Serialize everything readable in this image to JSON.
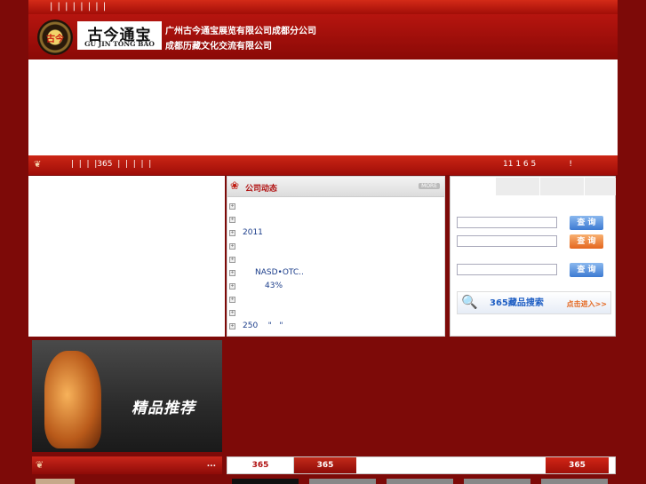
{
  "top_nav": {
    "text": "| | | | | | | |"
  },
  "header": {
    "logo_seal": "古今",
    "logo_cn": "古今通宝",
    "logo_en": "GU JIN TONG BAO",
    "company_line1": "广州古今通宝展览有限公司成都分公司",
    "company_line2": "成都历藏文化交流有限公司"
  },
  "menu": {
    "items_text": "|  |  |  |365  |  |  |  |  |",
    "marquee": "11 1 6 5             !"
  },
  "news": {
    "title": "公司动态",
    "more_label": "MORE",
    "items": [
      "",
      "",
      "2011",
      "",
      "",
      "NASD•OTC..",
      "43%",
      "",
      "",
      "250    \"   \""
    ]
  },
  "search": {
    "button_label": "查 询",
    "banner_title": "365藏品搜索",
    "banner_go": "点击进入>>"
  },
  "feature": {
    "caption": "精品推荐"
  },
  "bottom": {
    "left_dots": "...",
    "tab1": "365",
    "tab2": "365",
    "tab3": "365"
  },
  "colors": {
    "background": "#7d0a08",
    "brand_red": "#b6150f",
    "link_blue": "#1a3c8a",
    "button_blue": "#3d7ad2",
    "button_orange": "#e4661e"
  }
}
